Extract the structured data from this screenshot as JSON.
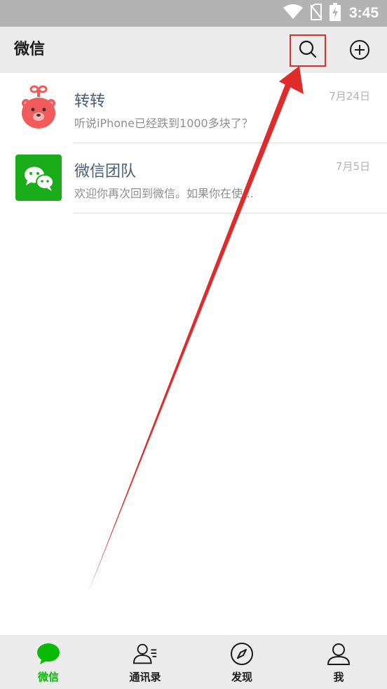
{
  "status_bar": {
    "time": "3:45",
    "icons": [
      "wifi-icon",
      "no-sim-icon",
      "battery-charging-icon"
    ]
  },
  "header": {
    "title": "微信",
    "search_icon": "search-icon",
    "add_icon": "add-circle-icon"
  },
  "chats": [
    {
      "name": "转转",
      "preview": "听说iPhone已经跌到1000多块了？",
      "time": "7月24日",
      "avatar_icon": "bear-avatar-icon",
      "avatar_color": "#f15b5b"
    },
    {
      "name": "微信团队",
      "preview": "欢迎你再次回到微信。如果你在使…",
      "time": "7月5日",
      "avatar_icon": "wechat-logo-icon",
      "avatar_color": "#1aad19"
    }
  ],
  "tabs": [
    {
      "label": "微信",
      "icon": "chat-bubble-icon",
      "active": true
    },
    {
      "label": "通讯录",
      "icon": "contacts-icon",
      "active": false
    },
    {
      "label": "发现",
      "icon": "compass-icon",
      "active": false
    },
    {
      "label": "我",
      "icon": "person-icon",
      "active": false
    }
  ],
  "colors": {
    "accent_green": "#09bb07",
    "highlight_red": "#d6322f",
    "status_bar_gray": "#b3b3b3",
    "header_gray": "#ececec"
  }
}
